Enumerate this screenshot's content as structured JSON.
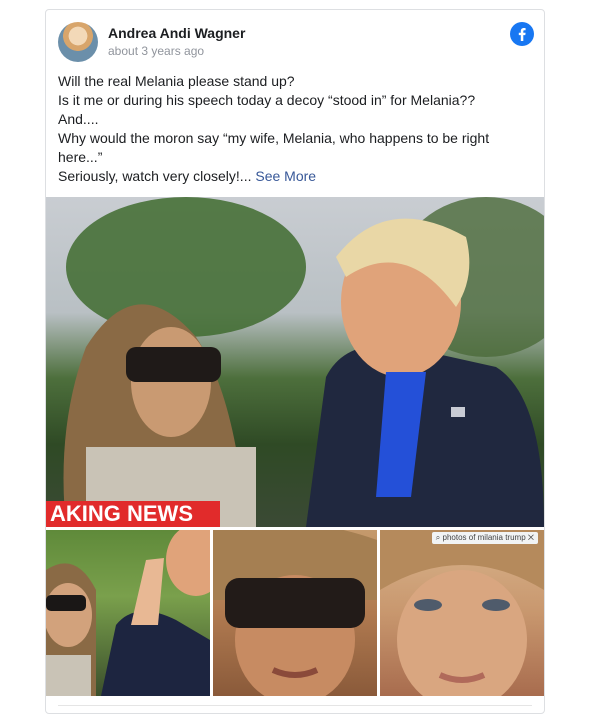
{
  "post": {
    "author": "Andrea Andi Wagner",
    "timestamp": "about 3 years ago",
    "lines": [
      "Will the real Melania please stand up?",
      "Is it me or during his speech today a decoy “stood in” for Melania??",
      "And....",
      "Why would the moron say “my wife, Melania, who happens to be right here...”",
      "Seriously, watch very closely!..."
    ],
    "see_more": "See More"
  },
  "media": {
    "banner_text": "AKING NEWS",
    "search_chip": "photos of milania trump"
  },
  "colors": {
    "facebook_blue": "#1877f2",
    "link": "#385898",
    "banner_red": "#e12b2b"
  },
  "icons": {
    "platform": "facebook-icon",
    "search": "search-icon",
    "close": "close-icon"
  }
}
